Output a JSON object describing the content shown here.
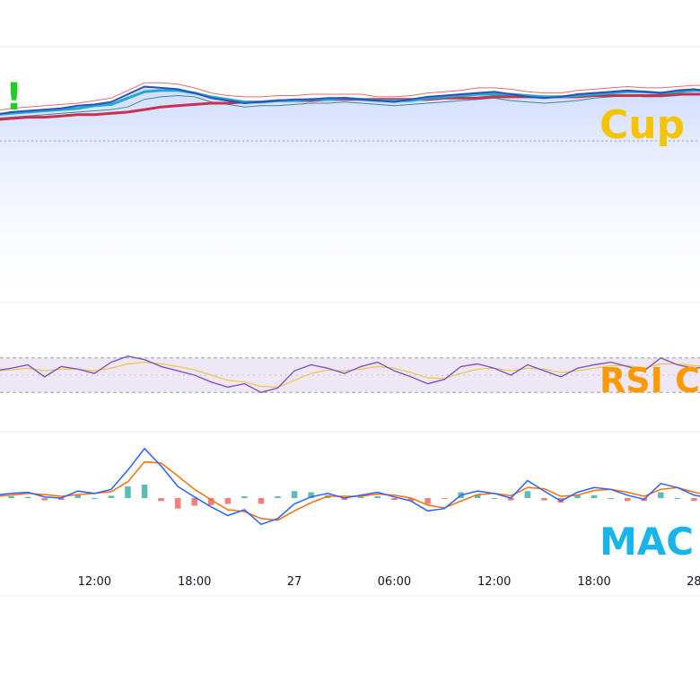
{
  "chart_data": {
    "type": "line",
    "xaxis": {
      "tick_labels": [
        "12:00",
        "18:00",
        "27",
        "06:00",
        "12:00",
        "18:00",
        "28"
      ],
      "tick_index": [
        6,
        12,
        18,
        24,
        30,
        36,
        42
      ]
    },
    "overlays": {
      "top_left_text": "!",
      "price_label": "Cup",
      "rsi_label": "RSI C",
      "macd_label": "MAC"
    },
    "colors": {
      "price": "#2a52be",
      "bb_upper": "#e66b6b",
      "bb_lower": "#3c8d8d",
      "ema_fast": "#22aacc",
      "ema_slow": "#c8324f",
      "area_fill": "#dde6ff",
      "rsi": "#7e57c2",
      "rsi_signal": "#f6c342",
      "rsi_band": "#ede7f6",
      "macd": "#2962ff",
      "macd_signal": "#ff6d00",
      "hist_pos": "#26a69a",
      "hist_neg": "#ef5350",
      "top_left_text": "#22cc22",
      "price_label": "#f5c400",
      "rsi_label": "#ff9900",
      "macd_label": "#19b5ea"
    },
    "panes": {
      "price": {
        "ylim": [
          0,
          100
        ],
        "price": [
          72,
          74,
          75,
          76,
          77,
          79,
          80,
          82,
          88,
          94,
          93,
          92,
          89,
          85,
          83,
          81,
          82,
          83,
          84,
          84,
          85,
          85,
          84,
          83,
          82,
          84,
          86,
          87,
          88,
          89,
          90,
          88,
          86,
          85,
          86,
          88,
          89,
          90,
          91,
          90,
          89,
          91,
          92,
          90
        ],
        "ema_fast": [
          72,
          73,
          74,
          75,
          76,
          77,
          79,
          80,
          85,
          90,
          91,
          91,
          89,
          86,
          84,
          82,
          82,
          83,
          83,
          84,
          84,
          85,
          84,
          83,
          83,
          83,
          85,
          86,
          87,
          88,
          88,
          88,
          87,
          86,
          86,
          87,
          88,
          89,
          90,
          90,
          89,
          90,
          91,
          91
        ],
        "ema_slow": [
          68,
          69,
          70,
          70,
          71,
          72,
          72,
          73,
          74,
          76,
          78,
          79,
          80,
          81,
          81,
          82,
          82,
          83,
          83,
          83,
          84,
          84,
          84,
          84,
          84,
          84,
          84,
          85,
          85,
          85,
          86,
          86,
          86,
          86,
          86,
          86,
          87,
          87,
          87,
          87,
          87,
          88,
          88,
          88
        ],
        "bb_upper": [
          75,
          77,
          78,
          79,
          80,
          81,
          83,
          85,
          91,
          97,
          97,
          96,
          93,
          89,
          87,
          86,
          86,
          87,
          87,
          88,
          88,
          88,
          88,
          86,
          86,
          87,
          89,
          90,
          91,
          93,
          93,
          92,
          90,
          89,
          89,
          91,
          92,
          93,
          94,
          93,
          93,
          94,
          95,
          95
        ],
        "bb_lower": [
          69,
          70,
          71,
          72,
          73,
          74,
          75,
          76,
          78,
          84,
          86,
          87,
          86,
          82,
          80,
          78,
          79,
          79,
          80,
          81,
          81,
          82,
          81,
          80,
          79,
          80,
          81,
          82,
          83,
          84,
          85,
          83,
          82,
          81,
          82,
          83,
          85,
          86,
          87,
          86,
          86,
          87,
          88,
          87
        ]
      },
      "rsi": {
        "ylim": [
          0,
          100
        ],
        "upper_band": 70,
        "lower_band": 30,
        "rsi": [
          55,
          58,
          62,
          48,
          60,
          57,
          52,
          65,
          72,
          68,
          60,
          55,
          50,
          42,
          36,
          40,
          30,
          35,
          55,
          62,
          58,
          52,
          60,
          65,
          55,
          48,
          40,
          45,
          60,
          63,
          58,
          50,
          62,
          55,
          48,
          58,
          62,
          65,
          60,
          55,
          70,
          62,
          58,
          60
        ],
        "signal": [
          55,
          56,
          58,
          55,
          57,
          57,
          55,
          58,
          63,
          65,
          63,
          60,
          56,
          50,
          44,
          42,
          37,
          36,
          44,
          52,
          56,
          55,
          57,
          60,
          58,
          53,
          47,
          46,
          52,
          57,
          58,
          55,
          58,
          57,
          53,
          55,
          58,
          61,
          61,
          58,
          63,
          63,
          61,
          60
        ]
      },
      "macd": {
        "ylim": [
          -100,
          100
        ],
        "macd": [
          5,
          8,
          10,
          2,
          0,
          12,
          8,
          15,
          48,
          85,
          55,
          20,
          2,
          -15,
          -30,
          -20,
          -45,
          -35,
          -10,
          2,
          8,
          0,
          5,
          10,
          2,
          -5,
          -22,
          -18,
          5,
          12,
          8,
          0,
          30,
          12,
          -5,
          10,
          18,
          15,
          5,
          -2,
          25,
          18,
          5,
          0
        ],
        "signal": [
          3,
          5,
          8,
          6,
          3,
          6,
          8,
          11,
          28,
          62,
          60,
          38,
          15,
          -3,
          -20,
          -23,
          -35,
          -38,
          -22,
          -8,
          3,
          3,
          3,
          7,
          5,
          0,
          -12,
          -17,
          -5,
          6,
          8,
          4,
          18,
          16,
          3,
          5,
          13,
          15,
          10,
          3,
          15,
          18,
          10,
          4
        ]
      }
    }
  }
}
